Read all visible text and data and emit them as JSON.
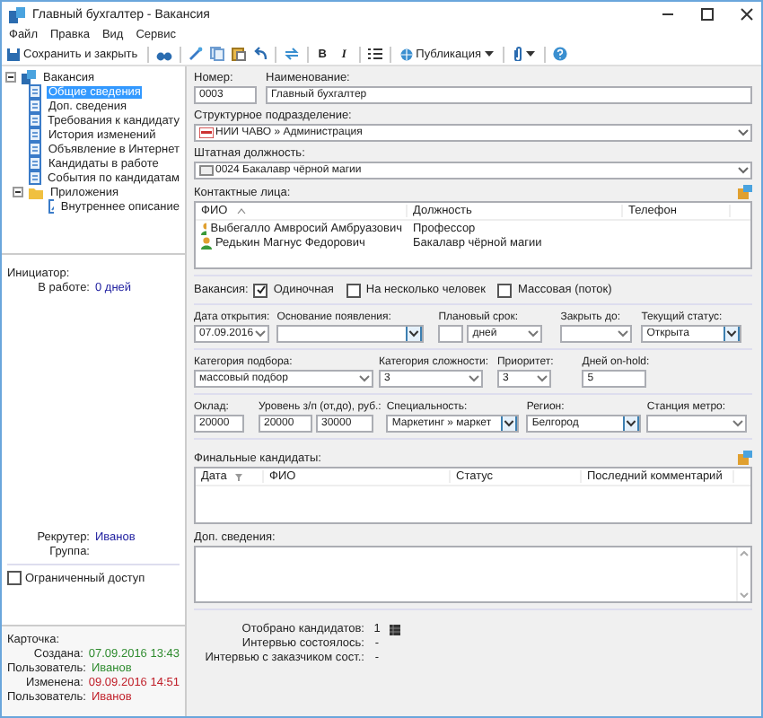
{
  "window": {
    "title": "Главный бухгалтер - Вакансия"
  },
  "menu": [
    "Файл",
    "Правка",
    "Вид",
    "Сервис"
  ],
  "toolbar": {
    "save_label": "Сохранить и закрыть",
    "format_buttons": [
      "B",
      "I"
    ],
    "publish_label": "Публикация"
  },
  "tree": {
    "label": "Вакансия",
    "expanded": true,
    "children": [
      {
        "label": "Общие сведения",
        "selected": true
      },
      {
        "label": "Доп. сведения",
        "selected": false
      },
      {
        "label": "Требования к кандидату",
        "selected": false
      },
      {
        "label": "История изменений",
        "selected": false
      },
      {
        "label": "Объявление в Интернет",
        "selected": false
      },
      {
        "label": "Кандидаты в работе",
        "selected": false
      },
      {
        "label": "События по кандидатам",
        "selected": false
      },
      {
        "label": "Приложения",
        "selected": false,
        "expanded": true,
        "children": [
          {
            "label": "Внутреннее описание",
            "selected": false
          }
        ]
      }
    ]
  },
  "info": {
    "initiator_label": "Инициатор:",
    "in_work_label": "В работе:",
    "in_work_value": "0 дней",
    "recruiter_label": "Рекрутер:",
    "recruiter_value": "Иванов",
    "group_label": "Группа:"
  },
  "restricted_access": {
    "label": "Ограниченный доступ",
    "checked": false
  },
  "card": {
    "title": "Карточка:",
    "rows": [
      {
        "label": "Создана:",
        "value": "07.09.2016 13:43",
        "color": "#2e8b2e"
      },
      {
        "label": "Пользователь:",
        "value": "Иванов",
        "color": "#2e8b2e"
      },
      {
        "label": "Изменена:",
        "value": "09.09.2016 14:51",
        "color": "#c0202a"
      },
      {
        "label": "Пользователь:",
        "value": "Иванов",
        "color": "#c0202a"
      }
    ]
  },
  "form": {
    "number": {
      "label": "Номер:",
      "value": "0003"
    },
    "name": {
      "label": "Наименование:",
      "value": "Главный бухгалтер"
    },
    "department": {
      "label": "Структурное подразделение:",
      "value": "НИИ ЧАВО  »  Администрация"
    },
    "position": {
      "label": "Штатная должность:",
      "value": "0024  Бакалавр чёрной магии"
    },
    "contacts": {
      "label": "Контактные лица:",
      "columns": [
        "ФИО",
        "Должность",
        "Телефон"
      ],
      "rows": [
        {
          "name": "Выбегалло Амвросий Амбруазович",
          "position": "Профессор"
        },
        {
          "name": "Редькин Магнус Федорович",
          "position": "Бакалавр чёрной магии"
        }
      ]
    },
    "vacancy_type": {
      "label": "Вакансия:",
      "options": [
        {
          "label": "Одиночная",
          "checked": true
        },
        {
          "label": "На несколько человек",
          "checked": false
        },
        {
          "label": "Массовая (поток)",
          "checked": false
        }
      ]
    },
    "field_rows": [
      [
        {
          "label": "Дата открытия:",
          "inputs": [
            {
              "kind": "dropdown",
              "value": "07.09.2016"
            }
          ]
        },
        {
          "label": "Основание появления:",
          "inputs": [
            {
              "kind": "combo"
            }
          ]
        },
        {
          "label": "Плановый срок:",
          "inputs": [
            {
              "kind": "text"
            },
            {
              "kind": "dropdown",
              "value": "дней"
            }
          ]
        },
        {
          "label": "Закрыть до:",
          "inputs": [
            {
              "kind": "dropdown"
            }
          ]
        },
        {
          "label": "Текущий статус:",
          "inputs": [
            {
              "kind": "combo",
              "value": "Открыта"
            }
          ]
        }
      ],
      [
        {
          "label": "Категория подбора:",
          "inputs": [
            {
              "kind": "dropdown",
              "value": "массовый подбор"
            }
          ]
        },
        {
          "label": "Категория сложности:",
          "inputs": [
            {
              "kind": "dropdown",
              "value": "3"
            }
          ]
        },
        {
          "label": "Приоритет:",
          "inputs": [
            {
              "kind": "dropdown",
              "value": "3"
            }
          ]
        },
        {
          "label": "Дней on-hold:",
          "inputs": [
            {
              "kind": "text",
              "value": "5"
            }
          ]
        }
      ],
      [
        {
          "label": "Оклад:",
          "inputs": [
            {
              "kind": "text",
              "value": "20000"
            }
          ]
        },
        {
          "label": "Уровень з/п (от,до), руб.:",
          "inputs": [
            {
              "kind": "text",
              "value": "20000"
            },
            {
              "kind": "text",
              "value": "30000"
            }
          ]
        },
        {
          "label": "Специальность:",
          "inputs": [
            {
              "kind": "combo",
              "value": "Маркетинг  »  маркет"
            }
          ]
        },
        {
          "label": "Регион:",
          "inputs": [
            {
              "kind": "combo",
              "value": "Белгород"
            }
          ]
        },
        {
          "label": "Станция метро:",
          "inputs": [
            {
              "kind": "dropdown"
            }
          ]
        }
      ]
    ],
    "finalists": {
      "label": "Финальные кандидаты:",
      "columns": [
        "Дата",
        "ФИО",
        "Статус",
        "Последний комментарий"
      ]
    },
    "notes": {
      "label": "Доп. сведения:"
    },
    "stats": [
      {
        "label": "Отобрано кандидатов:",
        "value": "1"
      },
      {
        "label": "Интервью состоялось:",
        "value": "-"
      },
      {
        "label": "Интервью с заказчиком сост.:",
        "value": "-"
      }
    ]
  }
}
